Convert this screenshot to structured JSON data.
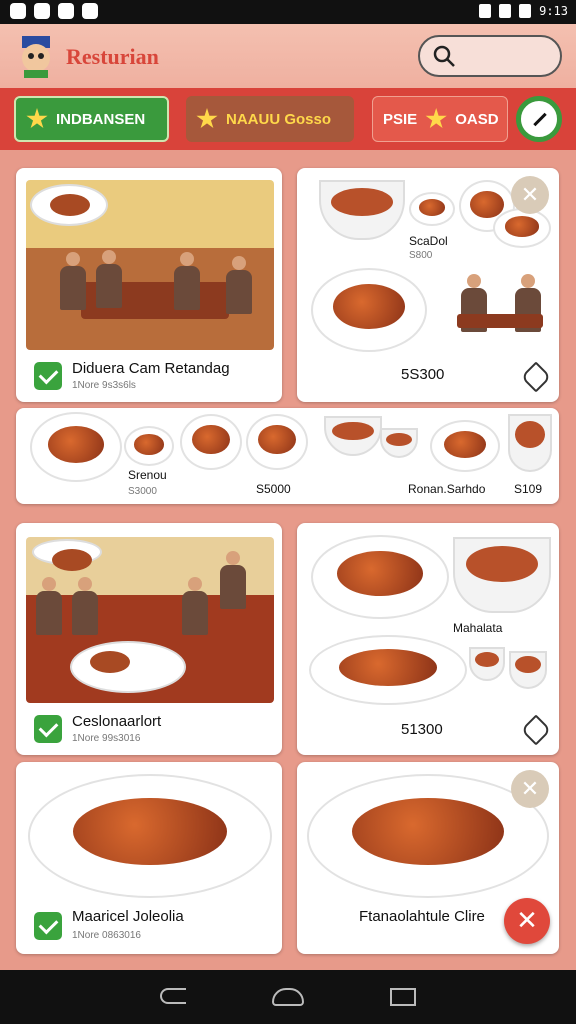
{
  "app": {
    "title": "Resturian"
  },
  "status_bar": {
    "time": "9:13"
  },
  "tabs": [
    {
      "label": "INDBANSEN"
    },
    {
      "label": "NAAUU Gosso"
    },
    {
      "label": "PSIE",
      "label2": "OASD"
    }
  ],
  "cards": {
    "c1": {
      "name": "Diduera Cam Retandag",
      "sub": "1Nore 9s3s6ls"
    },
    "c2": {
      "item": "ScaDol",
      "item_price": "S800",
      "price": "5S300"
    },
    "strip": {
      "i1": "Srenou",
      "p1": "S3000",
      "p2": "S5000",
      "i3": "Ronan.Sarhdo",
      "p3": "S109"
    },
    "c3": {
      "name": "Ceslonaarlort",
      "sub": "1Nore 99s3016"
    },
    "c4": {
      "item": "Mahalata",
      "price": "51300"
    },
    "c5": {
      "name": "Maaricel Joleolia",
      "sub": "1Nore 0863016"
    },
    "c6": {
      "name": "Ftanaolahtule Clire"
    }
  },
  "colors": {
    "accent": "#d9433a",
    "green": "#3a9a3d",
    "background": "#e79a8a"
  },
  "icons": [
    "search-icon",
    "star-icon",
    "edit-icon",
    "check-icon",
    "tag-icon",
    "close-icon",
    "back-icon",
    "home-icon",
    "recent-apps-icon"
  ]
}
